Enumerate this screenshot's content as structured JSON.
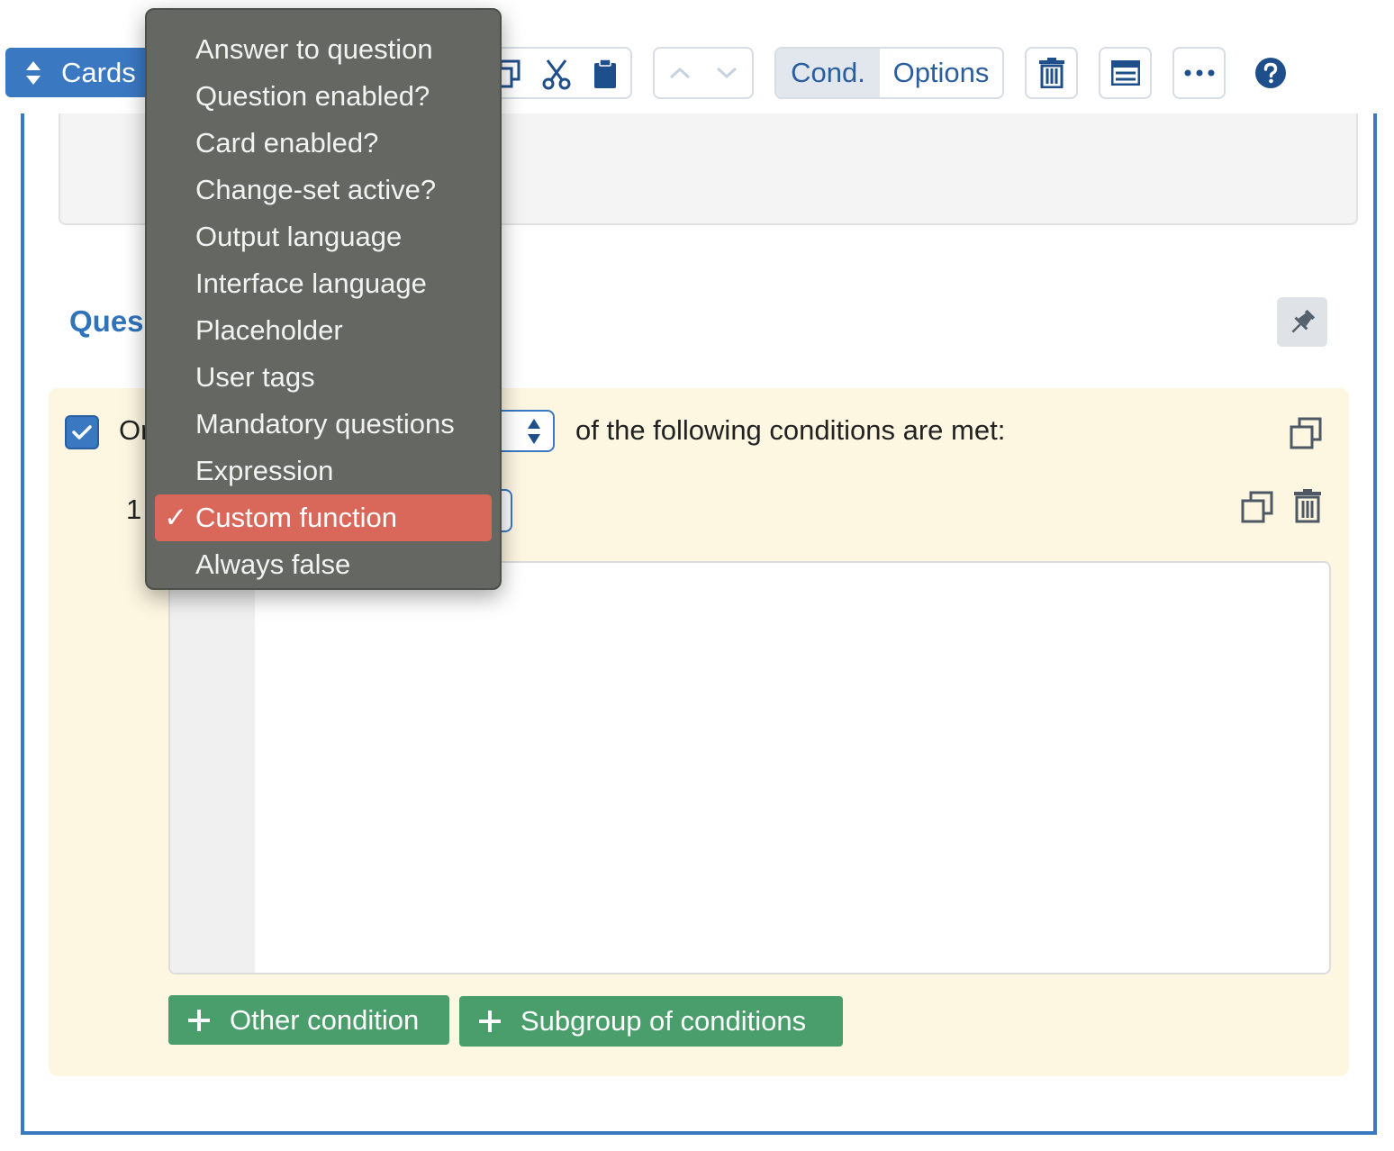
{
  "toolbar": {
    "cards_label": "Cards",
    "cond_tab_label": "Cond.",
    "options_tab_label": "Options",
    "icons": {
      "sort": "sort-icon",
      "copy": "copy-icon",
      "cut": "scissors-icon",
      "paste": "clipboard-icon",
      "move_up": "chevron-up-icon",
      "move_down": "chevron-down-icon",
      "delete": "trash-icon",
      "list": "list-icon",
      "more": "ellipsis-icon",
      "help": "question-circle-icon"
    }
  },
  "section": {
    "title": "Ques"
  },
  "conditions": {
    "group_prefix": "Or",
    "group_suffix": "of the following conditions are met:",
    "condition_number": "1",
    "buttons": {
      "other_condition": "Other condition",
      "subgroup": "Subgroup of conditions"
    }
  },
  "dropdown": {
    "items": [
      "Answer to question",
      "Question enabled?",
      "Card enabled?",
      "Change-set active?",
      "Output language",
      "Interface language",
      "Placeholder",
      "User tags",
      "Mandatory questions",
      "Expression",
      "Custom function",
      "Always false"
    ],
    "selected_index": 10,
    "check_mark": "✓"
  },
  "colors": {
    "accent": "#3a78c2",
    "menu_background": "#656762",
    "menu_selected": "#d9685a",
    "success": "#4a9e6b",
    "conditions_background": "#fdf6e1"
  }
}
